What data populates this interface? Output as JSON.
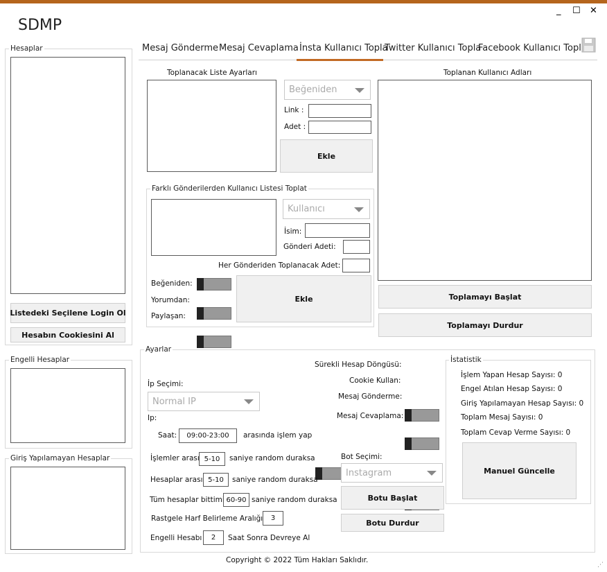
{
  "app": {
    "title": "SDMP"
  },
  "window_controls": {
    "minimize": "_",
    "maximize": "☐",
    "close": "✕"
  },
  "sidebar": {
    "accounts_label": "Hesaplar",
    "login_button": "Listedeki Seçilene Login Ol",
    "cookie_button": "Hesabın Cookiesini Al",
    "blocked_label": "Engelli Hesaplar",
    "failed_login_label": "Giriş Yapılamayan Hesaplar"
  },
  "tabs": [
    {
      "label": "Mesaj Gönderme"
    },
    {
      "label": "Mesaj Cevaplama"
    },
    {
      "label": "İnsta Kullanıcı Topla"
    },
    {
      "label": "Twitter Kullanıcı Topla"
    },
    {
      "label": "Facebook Kullanıcı Topla"
    }
  ],
  "collect": {
    "list_settings_label": "Toplanacak Liste Ayarları",
    "source_combo": "Beğeniden",
    "link_label": "Link :",
    "count_label": "Adet :",
    "add_button": "Ekle",
    "collected_label": "Toplanan Kullanıcı Adları",
    "start_button": "Toplamayı Başlat",
    "stop_button": "Toplamayı Durdur"
  },
  "multi": {
    "group_label": "Farklı Gönderilerden Kullanıcı Listesi Toplat",
    "type_combo": "Kullanıcı",
    "name_label": "İsim:",
    "post_count_label": "Gönderi Adeti:",
    "per_post_label": "Her Gönderiden Toplanacak Adet:",
    "likes_label": "Beğeniden:",
    "comments_label": "Yorumdan:",
    "shares_label": "Paylaşan:",
    "add_button": "Ekle"
  },
  "settings": {
    "group_label": "Ayarlar",
    "ip_selection_label": "İp Seçimi:",
    "ip_combo": "Normal IP",
    "ip_label": "Ip:",
    "time_label": "Saat:",
    "time_value": "09:00-23:00",
    "time_suffix": "arasında işlem yap",
    "loop_label": "Sürekli Hesap Döngüsü:",
    "cookie_label": "Cookie Kullan:",
    "msg_send_label": "Mesaj Gönderme:",
    "msg_reply_label": "Mesaj Cevaplama:",
    "between_ops_label": "İşlemler arası",
    "between_ops_value": "5-10",
    "between_ops_suffix": "saniye random duraksa",
    "between_accounts_label": "Hesaplar arası",
    "between_accounts_value": "5-10",
    "between_accounts_suffix": "saniye random duraksa",
    "all_done_label": "Tüm hesaplar bittimi",
    "all_done_value": "60-90",
    "all_done_suffix": "saniye random duraksa",
    "random_letter_label": "Rastgele Harf Belirleme Aralığı:",
    "random_letter_value": "3",
    "blocked_prefix": "Engelli Hesabı",
    "blocked_value": "2",
    "blocked_suffix": "Saat Sonra Devreye Al",
    "bot_label": "Bot Seçimi:",
    "bot_combo": "Instagram",
    "start_bot_button": "Botu Başlat",
    "stop_bot_button": "Botu Durdur"
  },
  "stats": {
    "group_label": "İstatistik",
    "processed": "İşlem Yapan Hesap Sayısı: 0",
    "blocked": "Engel Atılan Hesap Sayısı: 0",
    "failed_login": "Giriş Yapılamayan Hesap Sayısı: 0",
    "total_messages": "Toplam Mesaj Sayısı: 0",
    "total_replies": "Toplam Cevap Verme Sayısı: 0",
    "refresh_button": "Manuel Güncelle"
  },
  "footer": {
    "copyright": "Copyright © 2022 Tüm Hakları Saklıdır."
  }
}
